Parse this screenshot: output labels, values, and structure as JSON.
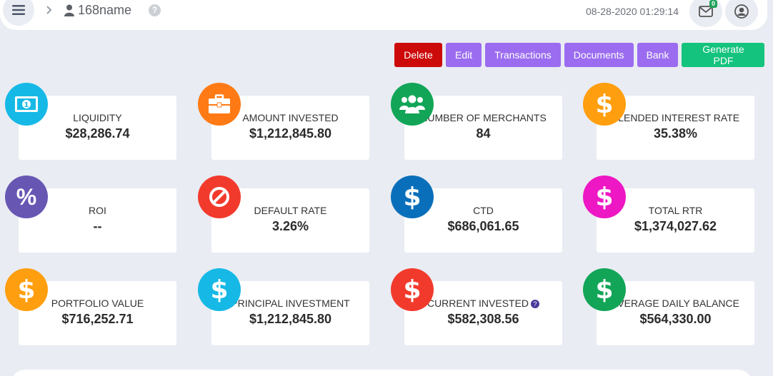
{
  "header": {
    "username": "168name",
    "help": "?",
    "datetime": "08-28-2020 01:29:14",
    "mail_count": "0"
  },
  "actions": {
    "delete": "Delete",
    "edit": "Edit",
    "transactions": "Transactions",
    "documents": "Documents",
    "bank": "Bank",
    "generate_pdf": "Generate PDF"
  },
  "colors": {
    "delete": "#cc0a0a",
    "purple": "#9b6cf0",
    "green": "#14c37d"
  },
  "cards": [
    {
      "label": "Liquidity",
      "value": "$28,286.74",
      "icon": "money-icon",
      "color": "#16b9e6"
    },
    {
      "label": "Amount Invested",
      "value": "$1,212,845.80",
      "icon": "briefcase-icon",
      "color": "#ff7a14"
    },
    {
      "label": "Number of Merchants",
      "value": "84",
      "icon": "users-icon",
      "color": "#12a558"
    },
    {
      "label": "Blended Interest Rate",
      "value": "35.38%",
      "icon": "dollar-icon",
      "color": "#ff9e0f"
    },
    {
      "label": "ROI",
      "value": "--",
      "icon": "percent-icon",
      "color": "#6757b3"
    },
    {
      "label": "Default Rate",
      "value": "3.26%",
      "icon": "ban-icon",
      "color": "#f23a2c"
    },
    {
      "label": "CTD",
      "value": "$686,061.65",
      "icon": "dollar-icon",
      "color": "#0a6fba"
    },
    {
      "label": "Total RTR",
      "value": "$1,374,027.62",
      "icon": "dollar-icon",
      "color": "#ee17c4"
    },
    {
      "label": "Portfolio Value",
      "value": "$716,252.71",
      "icon": "dollar-icon",
      "color": "#ff9e0f"
    },
    {
      "label": "Principal Investment",
      "value": "$1,212,845.80",
      "icon": "dollar-icon",
      "color": "#16b9e6"
    },
    {
      "label": "Current Invested",
      "value": "$582,308.56",
      "icon": "dollar-icon",
      "color": "#f23a2c"
    },
    {
      "label": "Average Daily Balance",
      "value": "$564,330.00",
      "icon": "dollar-icon",
      "color": "#12a558"
    }
  ]
}
